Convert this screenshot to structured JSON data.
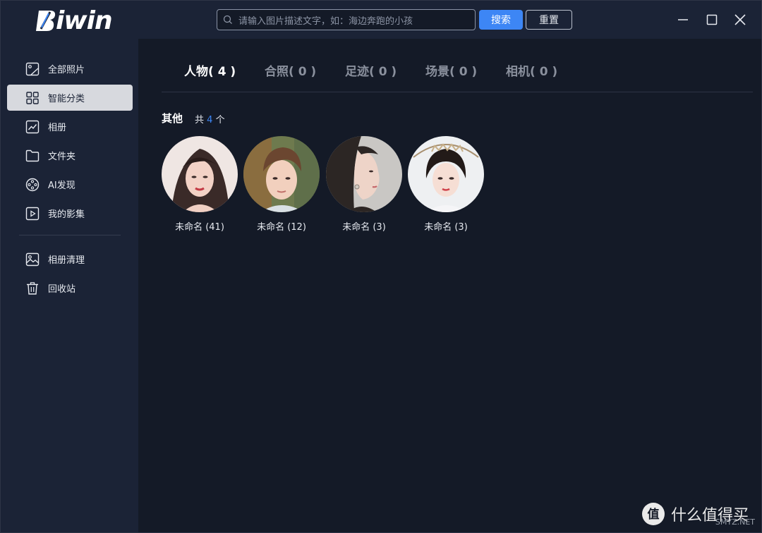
{
  "app": {
    "logo_text": "iwin"
  },
  "search": {
    "placeholder": "请输入图片描述文字，如：海边奔跑的小孩",
    "search_label": "搜索",
    "reset_label": "重置"
  },
  "sidebar": {
    "items": [
      {
        "label": "全部照片",
        "icon": "photo-icon"
      },
      {
        "label": "智能分类",
        "icon": "grid-icon"
      },
      {
        "label": "相册",
        "icon": "trend-icon"
      },
      {
        "label": "文件夹",
        "icon": "folder-icon"
      },
      {
        "label": "AI发现",
        "icon": "film-reel-icon"
      },
      {
        "label": "我的影集",
        "icon": "video-play-icon"
      },
      {
        "label": "相册清理",
        "icon": "image-icon"
      },
      {
        "label": "回收站",
        "icon": "trash-icon"
      }
    ],
    "active_index": 1
  },
  "tabs": [
    {
      "label": "人物( 4 )"
    },
    {
      "label": "合照( 0 )"
    },
    {
      "label": "足迹( 0 )"
    },
    {
      "label": "场景( 0 )"
    },
    {
      "label": "相机( 0 )"
    }
  ],
  "group": {
    "title": "其他",
    "count_prefix": "共",
    "count": "4",
    "count_suffix": "个"
  },
  "faces": [
    {
      "label": "未命名 (41)"
    },
    {
      "label": "未命名 (12)"
    },
    {
      "label": "未命名 (3)"
    },
    {
      "label": "未命名 (3)"
    }
  ],
  "watermark": {
    "text": "什么值得买",
    "sub": "SMYZ.NET"
  },
  "colors": {
    "accent": "#3d86f5",
    "background": "#141a27",
    "sidebar": "#1b2336",
    "active_nav": "#d7d9de"
  }
}
